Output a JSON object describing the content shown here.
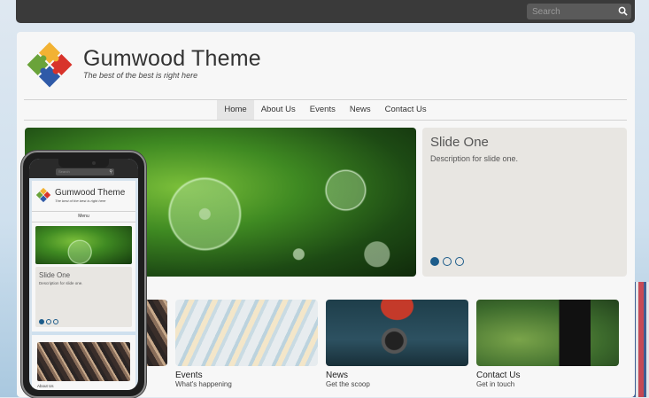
{
  "search": {
    "placeholder": "Search"
  },
  "site": {
    "title": "Gumwood Theme",
    "tagline": "The best of the best is right here"
  },
  "nav": {
    "items": [
      {
        "label": "Home",
        "active": true
      },
      {
        "label": "About Us",
        "active": false
      },
      {
        "label": "Events",
        "active": false
      },
      {
        "label": "News",
        "active": false
      },
      {
        "label": "Contact Us",
        "active": false
      }
    ]
  },
  "slider": {
    "title": "Slide One",
    "description": "Description for slide one.",
    "slide_count": 3,
    "active_index": 0
  },
  "features": [
    {
      "title": "",
      "subtitle": ""
    },
    {
      "title": "Events",
      "subtitle": "What's happening"
    },
    {
      "title": "News",
      "subtitle": "Get the scoop"
    },
    {
      "title": "Contact Us",
      "subtitle": "Get in touch"
    }
  ],
  "mobile": {
    "search_placeholder": "Search",
    "title": "Gumwood Theme",
    "tagline": "The best of the best is right here",
    "menu_label": "Menu",
    "slide_title": "Slide One",
    "slide_description": "Description for slide one.",
    "feature_label": "About Us"
  },
  "colors": {
    "accent": "#1d5c8a",
    "topbar": "#3a3a3a",
    "slide_panel": "#e8e6e2"
  }
}
